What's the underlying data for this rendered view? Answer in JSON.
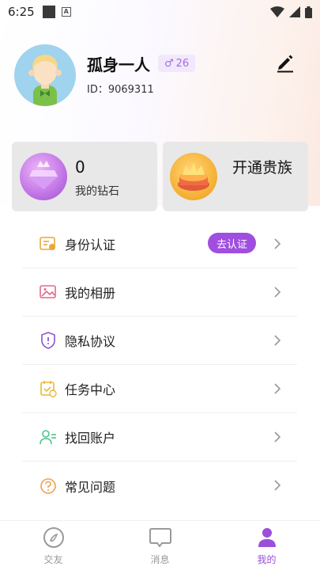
{
  "status": {
    "time": "6:25"
  },
  "profile": {
    "username": "孤身一人",
    "gender_symbol": "♂",
    "age": "26",
    "id_text": "ID：9069311"
  },
  "cards": {
    "diamond": {
      "count": "0",
      "label": "我的钻石"
    },
    "noble": {
      "label": "开通贵族"
    }
  },
  "menu": {
    "items": [
      {
        "label": "身份认证",
        "icon": "id-card-icon",
        "action": "去认证"
      },
      {
        "label": "我的相册",
        "icon": "photo-album-icon"
      },
      {
        "label": "隐私协议",
        "icon": "shield-icon"
      },
      {
        "label": "任务中心",
        "icon": "task-calendar-icon"
      },
      {
        "label": "找回账户",
        "icon": "user-recover-icon"
      },
      {
        "label": "常见问题",
        "icon": "question-circle-icon"
      }
    ]
  },
  "tabs": [
    {
      "label": "交友",
      "icon": "compass-icon",
      "active": false
    },
    {
      "label": "消息",
      "icon": "message-bubble-icon",
      "active": false
    },
    {
      "label": "我的",
      "icon": "person-icon",
      "active": true
    }
  ],
  "colors": {
    "accent": "#9a4fd8",
    "verify_button": "#a04ee0",
    "card_bg": "#e8e8e8",
    "avatar_bg": "#9fd3ee"
  }
}
